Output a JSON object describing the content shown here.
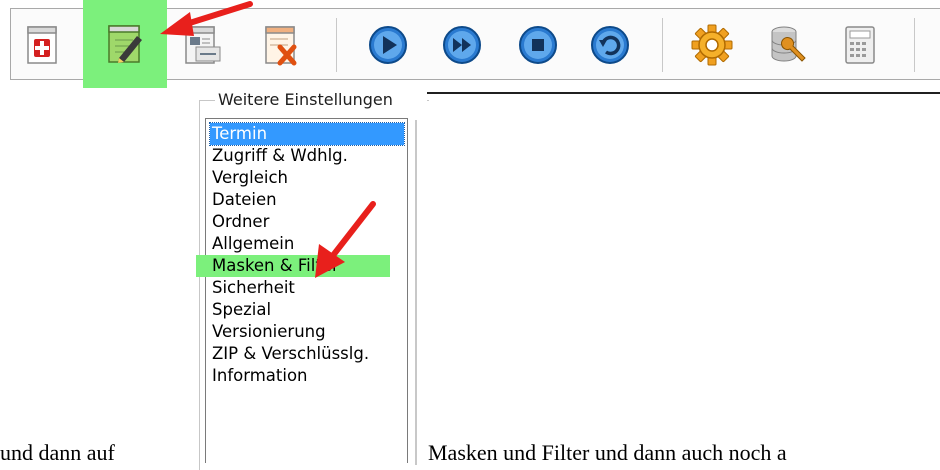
{
  "toolbar": {
    "buttons": [
      {
        "name": "add-job-icon",
        "accent": "#d42020"
      },
      {
        "name": "edit-job-icon",
        "accent": "#3fa845",
        "highlighted": true
      },
      {
        "name": "copy-job-icon",
        "accent": "#6a7a8a"
      },
      {
        "name": "delete-job-icon",
        "accent": "#e05010"
      },
      {
        "name": "play-icon",
        "accent": "#1f6fc0"
      },
      {
        "name": "fast-forward-icon",
        "accent": "#1f6fc0"
      },
      {
        "name": "stop-icon",
        "accent": "#1f6fc0"
      },
      {
        "name": "restore-icon",
        "accent": "#1f6fc0"
      },
      {
        "name": "gear-icon",
        "accent": "#f0a020"
      },
      {
        "name": "database-tool-icon",
        "accent": "#909090"
      },
      {
        "name": "calculator-icon",
        "accent": "#909090"
      }
    ]
  },
  "settings": {
    "legend": "Weitere Einstellungen",
    "items": [
      {
        "label": "Termin",
        "selected": true
      },
      {
        "label": "Zugriff & Wdhlg."
      },
      {
        "label": "Vergleich"
      },
      {
        "label": "Dateien"
      },
      {
        "label": "Ordner"
      },
      {
        "label": "Allgemein"
      },
      {
        "label": "Masken & Filter",
        "marked": true
      },
      {
        "label": "Sicherheit"
      },
      {
        "label": "Spezial"
      },
      {
        "label": "Versionierung"
      },
      {
        "label": "ZIP & Verschlüsslg."
      },
      {
        "label": "Information"
      }
    ]
  },
  "caption": {
    "before": "und dann auf",
    "after": "Masken und Filter und dann auch noch a"
  },
  "colors": {
    "highlight": "#7cf07c",
    "selection": "#3399ff",
    "arrow": "#e8201c"
  }
}
